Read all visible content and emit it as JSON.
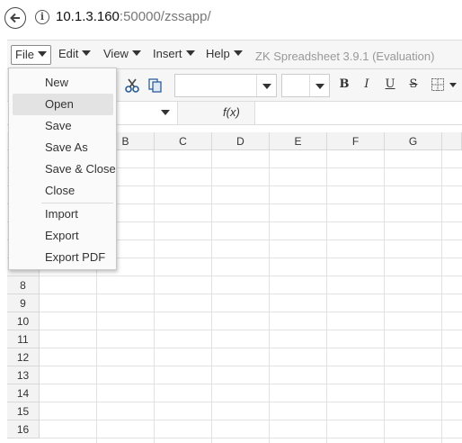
{
  "browser": {
    "url_host": "10.1.3.160",
    "url_rest": ":50000/zssapp/"
  },
  "menubar": {
    "items": [
      {
        "label": "File"
      },
      {
        "label": "Edit"
      },
      {
        "label": "View"
      },
      {
        "label": "Insert"
      },
      {
        "label": "Help"
      }
    ],
    "app_title": "ZK Spreadsheet 3.9.1 (Evaluation)"
  },
  "toolbar": {
    "icons": [
      "cut-icon",
      "copy-icon"
    ],
    "format_buttons": [
      "B",
      "I",
      "U",
      "S"
    ]
  },
  "formula": {
    "fx_label": "f(x)"
  },
  "grid": {
    "columns": [
      "B",
      "C",
      "D",
      "E",
      "F",
      "G"
    ],
    "rows": [
      "8",
      "9",
      "10",
      "11",
      "12",
      "13",
      "14",
      "15",
      "16"
    ]
  },
  "file_menu": {
    "items": [
      {
        "label": "New",
        "highlighted": false
      },
      {
        "label": "Open",
        "highlighted": true
      },
      {
        "label": "Save",
        "highlighted": false
      },
      {
        "label": "Save As",
        "highlighted": false
      },
      {
        "label": "Save & Close",
        "highlighted": false
      },
      {
        "label": "Close",
        "highlighted": false
      },
      {
        "label": "Import",
        "highlighted": false
      },
      {
        "label": "Export",
        "highlighted": false
      },
      {
        "label": "Export PDF",
        "highlighted": false
      }
    ]
  }
}
